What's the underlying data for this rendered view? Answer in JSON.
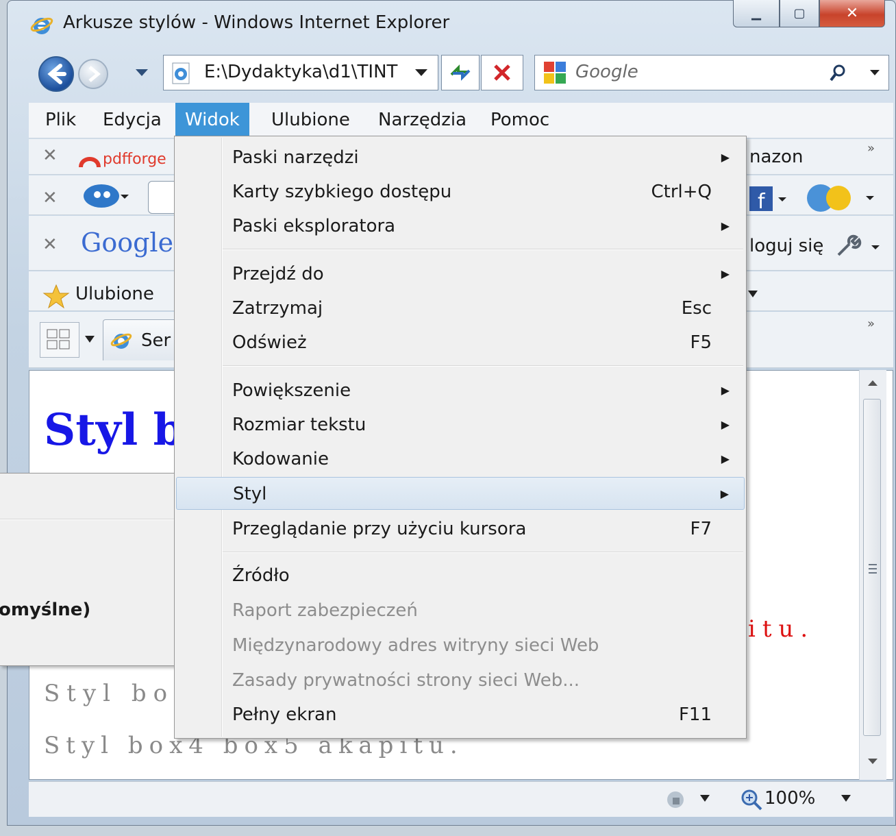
{
  "window": {
    "title": "Arkusze stylów - Windows Internet Explorer",
    "caption_buttons": [
      "minimize-icon",
      "maximize-icon",
      "close-icon"
    ]
  },
  "nav": {
    "address": "E:\\Dydaktyka\\d1\\TINT",
    "search_placeholder": "Google"
  },
  "menubar": {
    "items": [
      "Plik",
      "Edycja",
      "Widok",
      "Ulubione",
      "Narzędzia",
      "Pomoc"
    ],
    "active": "Widok"
  },
  "toolbars": {
    "pdfforge": "pdfforge",
    "amazon_partial": "nazon",
    "google_logo": "Google",
    "login_partial": "loguj się",
    "favorites": "Ulubione",
    "tab_partial": "Ser"
  },
  "page": {
    "heading_partial": "Styl b",
    "red_text_partial": "itu.",
    "gray_line1_partial": "Styl bo",
    "gray_line2": "Styl box4 box5 akapitu."
  },
  "submenu": {
    "partial_item": "omyślne)"
  },
  "view_menu": {
    "items": [
      {
        "label": "Paski narzędzi",
        "shortcut": "",
        "submenu": true
      },
      {
        "label": "Karty szybkiego dostępu",
        "shortcut": "Ctrl+Q",
        "submenu": false
      },
      {
        "label": "Paski eksploratora",
        "shortcut": "",
        "submenu": true
      },
      {
        "label": "Przejdź do",
        "shortcut": "",
        "submenu": true
      },
      {
        "label": "Zatrzymaj",
        "shortcut": "Esc",
        "submenu": false
      },
      {
        "label": "Odśwież",
        "shortcut": "F5",
        "submenu": false
      },
      {
        "label": "Powiększenie",
        "shortcut": "",
        "submenu": true
      },
      {
        "label": "Rozmiar tekstu",
        "shortcut": "",
        "submenu": true
      },
      {
        "label": "Kodowanie",
        "shortcut": "",
        "submenu": true
      },
      {
        "label": "Styl",
        "shortcut": "",
        "submenu": true,
        "highlighted": true
      },
      {
        "label": "Przeglądanie przy użyciu kursora",
        "shortcut": "F7",
        "submenu": false
      },
      {
        "label": "Źródło",
        "shortcut": "",
        "submenu": false
      },
      {
        "label": "Raport zabezpieczeń",
        "shortcut": "",
        "submenu": false,
        "disabled": true
      },
      {
        "label": "Międzynarodowy adres witryny sieci Web",
        "shortcut": "",
        "submenu": false,
        "disabled": true
      },
      {
        "label": "Zasady prywatności strony sieci Web...",
        "shortcut": "",
        "submenu": false,
        "disabled": true
      },
      {
        "label": "Pełny ekran",
        "shortcut": "F11",
        "submenu": false
      }
    ]
  },
  "status": {
    "zoom": "100%"
  }
}
